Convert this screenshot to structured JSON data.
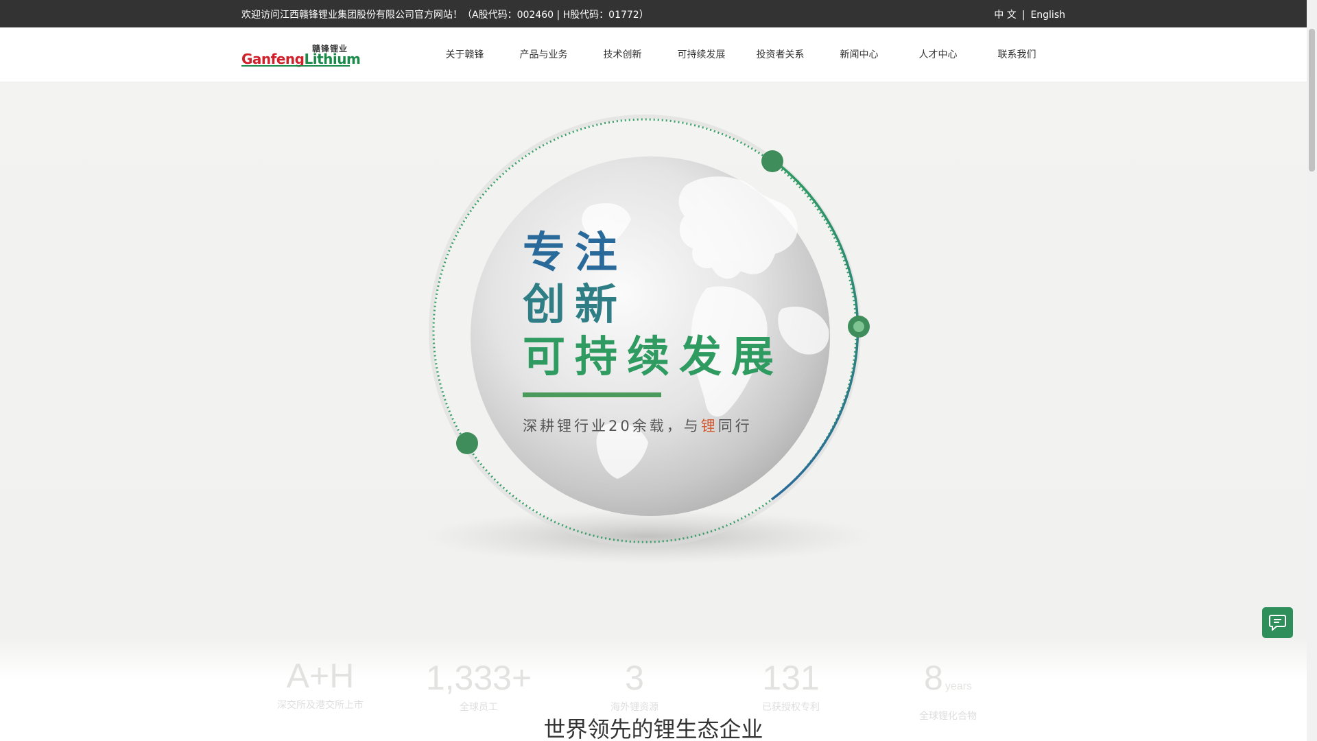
{
  "topbar": {
    "welcome": "欢迎访问江西赣锋锂业集团股份有限公司官方网站！（A股代码：002460 | H股代码：01772）",
    "lang_cn": "中 文",
    "lang_sep": "|",
    "lang_en": "English"
  },
  "logo": {
    "cn": "赣锋锂业",
    "en_part1": "Ganfeng",
    "en_part2": "Lithium"
  },
  "nav": {
    "items": [
      {
        "label": "关于赣锋"
      },
      {
        "label": "产品与业务"
      },
      {
        "label": "技术创新"
      },
      {
        "label": "可持续发展"
      },
      {
        "label": "投资者关系"
      },
      {
        "label": "新闻中心"
      },
      {
        "label": "人才中心"
      },
      {
        "label": "联系我们"
      }
    ]
  },
  "hero": {
    "line1": "专注",
    "line2": "创新",
    "line3": "可持续发展",
    "sub_before": "深耕锂行业20余载，与",
    "sub_highlight": "锂",
    "sub_after": "同行"
  },
  "stats": [
    {
      "num": "A+H",
      "unit": "",
      "label": "深交所及港交所上市"
    },
    {
      "num": "1,333+",
      "unit": "",
      "label": "全球员工"
    },
    {
      "num": "3",
      "unit": "",
      "label": "海外锂资源"
    },
    {
      "num": "131",
      "unit": "",
      "label": "已获授权专利"
    },
    {
      "num": "8",
      "unit": "years",
      "label": "全球锂化合物"
    }
  ],
  "section": {
    "title": "世界领先的锂生态企业"
  },
  "colors": {
    "topbar_bg": "#333333",
    "brand_green": "#2f9b61",
    "brand_blue": "#2a6a9a",
    "brand_red": "#d0202a",
    "chat_bg": "#2f8f5a"
  },
  "icons": {
    "chat": "chat-bubble-icon"
  }
}
